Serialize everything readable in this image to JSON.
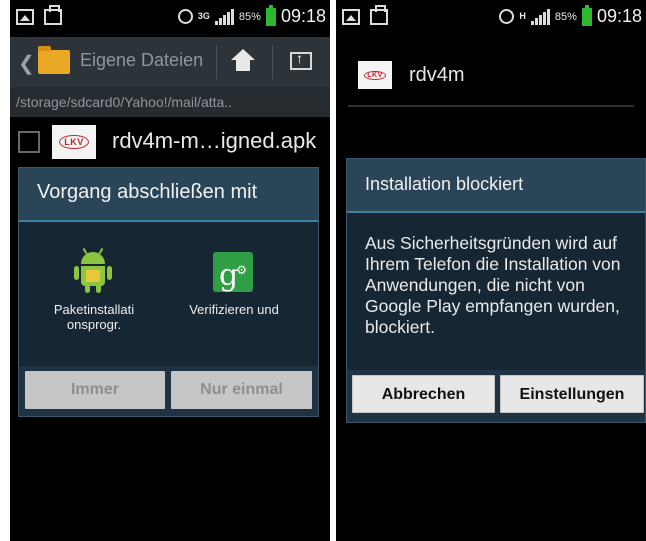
{
  "left_screen": {
    "status_bar": {
      "network": "3G",
      "battery": "85%",
      "time": "09:18"
    },
    "action_bar": {
      "title": "Eigene Dateien"
    },
    "path": "/storage/sdcard0/Yahoo!/mail/atta..",
    "file": {
      "name": "rdv4m-m…igned.apk",
      "logo_text": "LKV"
    },
    "dialog": {
      "title": "Vorgang abschließen mit",
      "options": [
        {
          "label": "Paketinstallati onsprogr.",
          "icon": "android-installer-icon"
        },
        {
          "label": "Verifizieren und",
          "icon": "google-plus-settings-icon"
        }
      ],
      "buttons": {
        "always": "Immer",
        "once": "Nur einmal"
      }
    }
  },
  "right_screen": {
    "status_bar": {
      "network": "H",
      "battery": "85%",
      "time": "09:18"
    },
    "app": {
      "name": "rdv4m",
      "logo_text": "LKV"
    },
    "dialog": {
      "title": "Installation blockiert",
      "message": "Aus Sicherheitsgründen wird auf Ihrem Telefon die Installation von Anwendungen, die nicht von Google Play empfangen wurden, blockiert.",
      "buttons": {
        "cancel": "Abbrechen",
        "settings": "Einstellungen"
      }
    }
  },
  "colors": {
    "dialog_background": "#162633",
    "dialog_title_background": "#2b4558",
    "title_accent": "#3e7fa8",
    "battery_green": "#2eb82e"
  }
}
